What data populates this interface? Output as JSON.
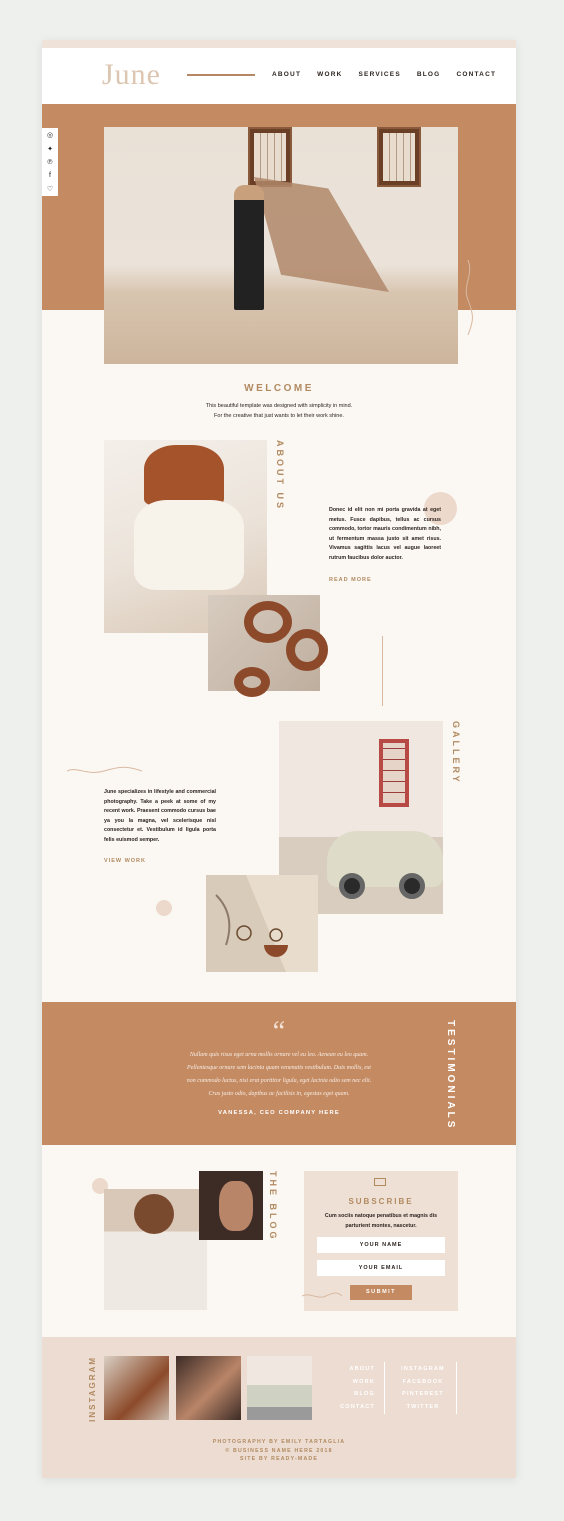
{
  "brand": {
    "logo": "June"
  },
  "nav": [
    "ABOUT",
    "WORK",
    "SERVICES",
    "BLOG",
    "CONTACT"
  ],
  "social_icons": [
    "instagram-icon",
    "twitter-icon",
    "pinterest-icon",
    "facebook-icon",
    "heart-icon"
  ],
  "welcome": {
    "title": "WELCOME",
    "line1": "This beautiful template was designed with simplicity in mind.",
    "line2": "For the creative that just wants to let their work shine."
  },
  "about": {
    "title": "ABOUT US",
    "text": "Donec id elit non mi porta gravida at eget metus. Fusce dapibus, tellus ac cursus commodo, tortor mauris condimentum nibh, ut fermentum massa justo sit amet risus. Vivamus sagittis lacus vel augue laoreet rutrum faucibus dolor auctor.",
    "link": "READ MORE"
  },
  "gallery": {
    "title": "GALLERY",
    "text": "June specializes in lifestyle and commercial photography. Take a peek at some of my recent work. Praesent commodo cursus bae ya you la magna, vel scelerisque nisl consectetur et. Vestibulum id ligula porta felis euismod semper.",
    "link": "VIEW WORK"
  },
  "testimonials": {
    "title": "TESTIMONIALS",
    "quote_mark": "“",
    "lines": [
      "Nullam quis risus eget urna mollis ornare vel eu leo. Aenean eu leo quam.",
      "Pellentesque ornare sem lacinia quam venenatis vestibulum. Duis mollis, est",
      "non commodo luctus, nisi erat porttitor ligula, eget lacinia odio sem nec elit.",
      "Cras justo odio, dapibus ac facilisis in, egestas eget quam."
    ],
    "author": "VANESSA, CEO COMPANY HERE"
  },
  "blog": {
    "title": "THE BLOG"
  },
  "subscribe": {
    "title": "SUBSCRIBE",
    "line1": "Cum sociis natoque penatibus et magnis dis",
    "line2": "parturient montes, nascetur.",
    "name_placeholder": "YOUR NAME",
    "email_placeholder": "YOUR EMAIL",
    "button": "SUBMIT"
  },
  "footer": {
    "instagram_title": "INSTAGRAM",
    "links_left": [
      "ABOUT",
      "WORK",
      "BLOG",
      "CONTACT"
    ],
    "links_right": [
      "INSTAGRAM",
      "FACEBOOK",
      "PINTEREST",
      "TWITTER"
    ],
    "credit1": "PHOTOGRAPHY BY EMILY TARTAGLIA",
    "credit2": "© BUSINESS NAME HERE 2018",
    "credit3": "SITE BY READY-MADE"
  },
  "colors": {
    "accent": "#c48a62",
    "gold": "#b18a60",
    "blush": "#ecdcd1"
  }
}
